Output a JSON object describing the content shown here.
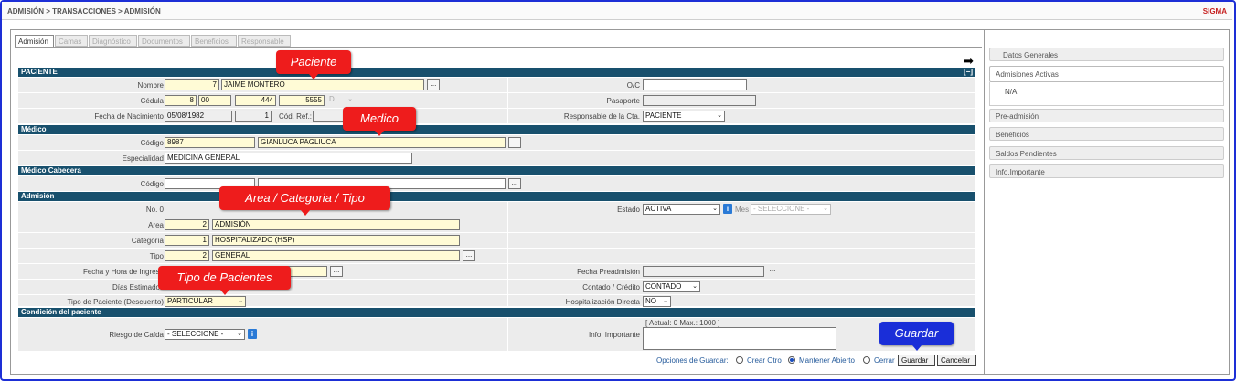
{
  "header": {
    "breadcrumb": "ADMISIÓN > TRANSACCIONES > ADMISIÓN",
    "brand": "SIGMA"
  },
  "tabs": [
    "Admisión",
    "Camas",
    "Diagnóstico",
    "Documentos",
    "Beneficios",
    "Responsable"
  ],
  "icons": {
    "next": "arrow-right-icon",
    "info": "info-icon",
    "lookup": "ellipsis-icon"
  },
  "sections": {
    "paciente": "PACIENTE",
    "toggle": "[−]",
    "medico": "Médico",
    "medico_cabecera": "Médico Cabecera",
    "admision": "Admisión",
    "condicion": "Condición del paciente"
  },
  "paciente": {
    "nombre_label": "Nombre",
    "nombre_num": "7",
    "nombre": "JAIME MONTERO",
    "oc_label": "O/C",
    "oc": "",
    "cedula_label": "Cédula",
    "cedula_1": "8",
    "cedula_2": "00",
    "cedula_3": "444",
    "cedula_4": "5555",
    "cedula_5": "D",
    "pasaporte_label": "Pasaporte",
    "pasaporte": "",
    "fecha_nac_label": "Fecha de Nacimiento",
    "fecha_nac": "05/08/1982",
    "edad": "1",
    "cod_ref_label": "Cód. Ref.:",
    "cod_ref": "",
    "responsable_label": "Responsable de la Cta.",
    "responsable": "PACIENTE"
  },
  "medico": {
    "codigo_label": "Código",
    "codigo": "8987",
    "nombre": "GIANLUCA PAGLIUCA",
    "especialidad_label": "Especialidad",
    "especialidad": "MEDICINA GENERAL"
  },
  "medico_cabecera": {
    "codigo_label": "Código",
    "codigo": "",
    "nombre": ""
  },
  "admision": {
    "no_label": "No. 0",
    "estado_label": "Estado",
    "estado": "ACTIVA",
    "mes_label": "Mes",
    "mes": "- SELECCIONE -",
    "area_label": "Area",
    "area_num": "2",
    "area": "ADMISIÓN",
    "categoria_label": "Categoría",
    "categoria_num": "1",
    "categoria": "HOSPITALIZADO (HSP)",
    "tipo_label": "Tipo",
    "tipo_num": "2",
    "tipo": "GENERAL",
    "fecha_ingreso_label": "Fecha y Hora de Ingreso",
    "fecha_preadm_label": "Fecha Preadmisión",
    "dias_label": "Días Estimados",
    "contado_label": "Contado / Crédito",
    "contado": "CONTADO",
    "tipo_paciente_label": "Tipo de Paciente (Descuento)",
    "tipo_paciente": "PARTICULAR",
    "hosp_directa_label": "Hospitalización Directa",
    "hosp_directa": "NO"
  },
  "condicion": {
    "riesgo_label": "Riesgo de Caída",
    "riesgo": "- SELECCIONE -",
    "info_label": "Info. Importante",
    "contador": "[ Actual: 0   Max.: 1000 ]"
  },
  "footer": {
    "opciones_label": "Opciones de Guardar:",
    "opt1": "Crear Otro",
    "opt2": "Mantener Abierto",
    "opt3": "Cerrar",
    "guardar": "Guardar",
    "cancelar": "Cancelar"
  },
  "callouts": {
    "paciente": "Paciente",
    "medico": "Medico",
    "area": "Area / Categoria / Tipo",
    "tipo_pacientes": "Tipo de Pacientes",
    "guardar": "Guardar"
  },
  "sidebar": {
    "datos_generales": "Datos Generales",
    "admisiones_activas": "Admisiones Activas",
    "na": "N/A",
    "pre_admision": "Pre-admisión",
    "beneficios": "Beneficios",
    "saldos": "Saldos Pendientes",
    "info": "Info.Importante"
  },
  "colors": {
    "section_bar": "#18506d",
    "callout_red": "#ee1c1c",
    "callout_blue": "#1a2ed8",
    "frame": "#1d2fd6",
    "field_yellow": "#fffbd6"
  }
}
